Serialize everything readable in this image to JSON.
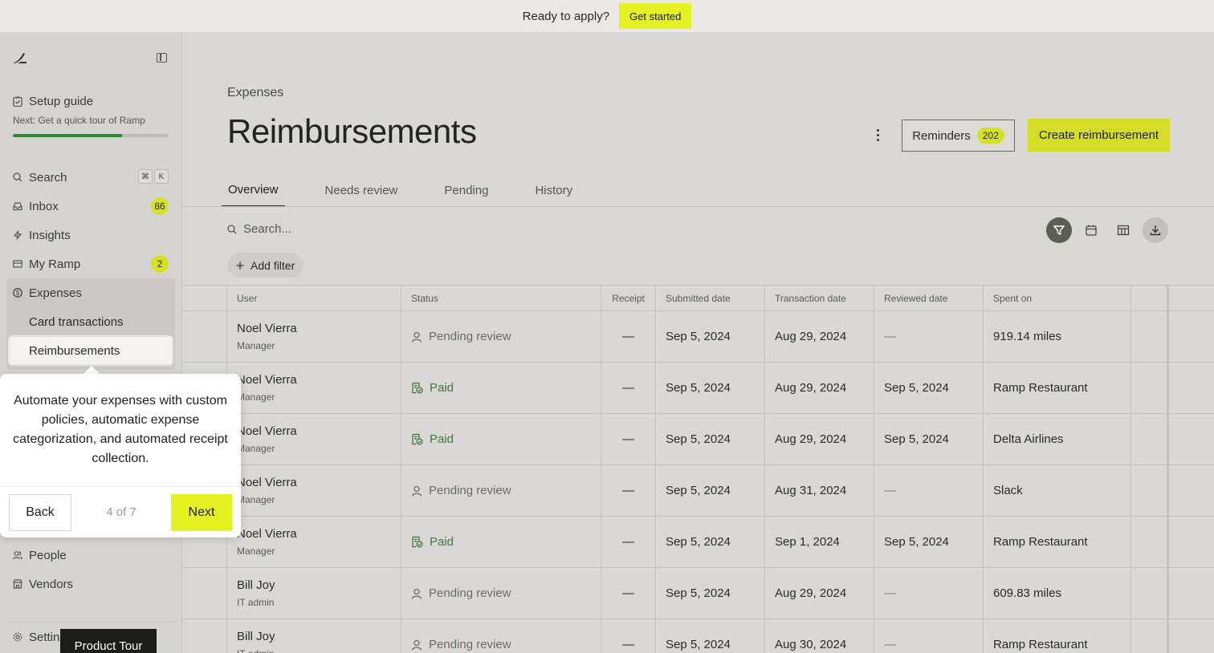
{
  "banner": {
    "text": "Ready to apply?",
    "button": "Get started"
  },
  "sidebar": {
    "setup_title": "Setup guide",
    "setup_next": "Next: Get a quick tour of Ramp",
    "setup_progress": 0.7,
    "items": [
      {
        "label": "Search",
        "shortcut": [
          "⌘",
          "K"
        ]
      },
      {
        "label": "Inbox",
        "badge": "86"
      },
      {
        "label": "Insights"
      },
      {
        "label": "My Ramp",
        "badge": "2"
      },
      {
        "label": "Expenses"
      }
    ],
    "sub_items": [
      {
        "label": "Card transactions"
      },
      {
        "label": "Reimbursements"
      }
    ],
    "items2": [
      {
        "label": "People"
      },
      {
        "label": "Vendors"
      }
    ],
    "settings": "Setting"
  },
  "main": {
    "breadcrumb": "Expenses",
    "title": "Reimbursements",
    "reminders": {
      "label": "Reminders",
      "count": "202"
    },
    "create_button": "Create reimbursement",
    "tabs": [
      "Overview",
      "Needs review",
      "Pending",
      "History"
    ],
    "search_placeholder": "Search...",
    "add_filter": "Add filter"
  },
  "table": {
    "headers": [
      "User",
      "Status",
      "Receipt",
      "Submitted date",
      "Transaction date",
      "Reviewed date",
      "Spent on"
    ],
    "rows": [
      {
        "name": "Noel Vierra",
        "role": "Manager",
        "status": "Pending review",
        "receipt": "—",
        "submitted": "Sep 5, 2024",
        "transaction": "Aug 29, 2024",
        "reviewed": "—",
        "spent_on": "919.14 miles"
      },
      {
        "name": "Noel Vierra",
        "role": "Manager",
        "status": "Paid",
        "receipt": "—",
        "submitted": "Sep 5, 2024",
        "transaction": "Aug 29, 2024",
        "reviewed": "Sep 5, 2024",
        "spent_on": "Ramp Restaurant"
      },
      {
        "name": "Noel Vierra",
        "role": "Manager",
        "status": "Paid",
        "receipt": "—",
        "submitted": "Sep 5, 2024",
        "transaction": "Aug 29, 2024",
        "reviewed": "Sep 5, 2024",
        "spent_on": "Delta Airlines"
      },
      {
        "name": "Noel Vierra",
        "role": "Manager",
        "status": "Pending review",
        "receipt": "—",
        "submitted": "Sep 5, 2024",
        "transaction": "Aug 31, 2024",
        "reviewed": "—",
        "spent_on": "Slack"
      },
      {
        "name": "Noel Vierra",
        "role": "Manager",
        "status": "Paid",
        "receipt": "—",
        "submitted": "Sep 5, 2024",
        "transaction": "Sep 1, 2024",
        "reviewed": "Sep 5, 2024",
        "spent_on": "Ramp Restaurant"
      },
      {
        "name": "Bill Joy",
        "role": "IT admin",
        "status": "Pending review",
        "receipt": "—",
        "submitted": "Sep 5, 2024",
        "transaction": "Aug 29, 2024",
        "reviewed": "—",
        "spent_on": "609.83 miles"
      },
      {
        "name": "Bill Joy",
        "role": "IT admin",
        "status": "Pending review",
        "receipt": "—",
        "submitted": "Sep 5, 2024",
        "transaction": "Aug 30, 2024",
        "reviewed": "—",
        "spent_on": "Ramp Restaurant"
      }
    ]
  },
  "tour": {
    "text": "Automate your expenses with custom policies, automatic expense categorization, and automated receipt collection.",
    "back": "Back",
    "step": "4 of 7",
    "next": "Next"
  },
  "product_tour": "Product Tour",
  "colors": {
    "accent": "#e4f222",
    "paid": "#3d7a3e",
    "progress": "#2f8a3a"
  },
  "icons": [
    "ramp-logo-icon",
    "sidebar-toggle-icon",
    "checklist-icon",
    "search-icon",
    "inbox-icon",
    "insights-icon",
    "card-icon",
    "expenses-icon",
    "people-icon",
    "vendors-icon",
    "settings-icon",
    "more-vertical-icon",
    "filter-icon",
    "calendar-icon",
    "table-icon",
    "download-icon",
    "plus-icon",
    "user-icon",
    "paid-receipt-icon"
  ]
}
